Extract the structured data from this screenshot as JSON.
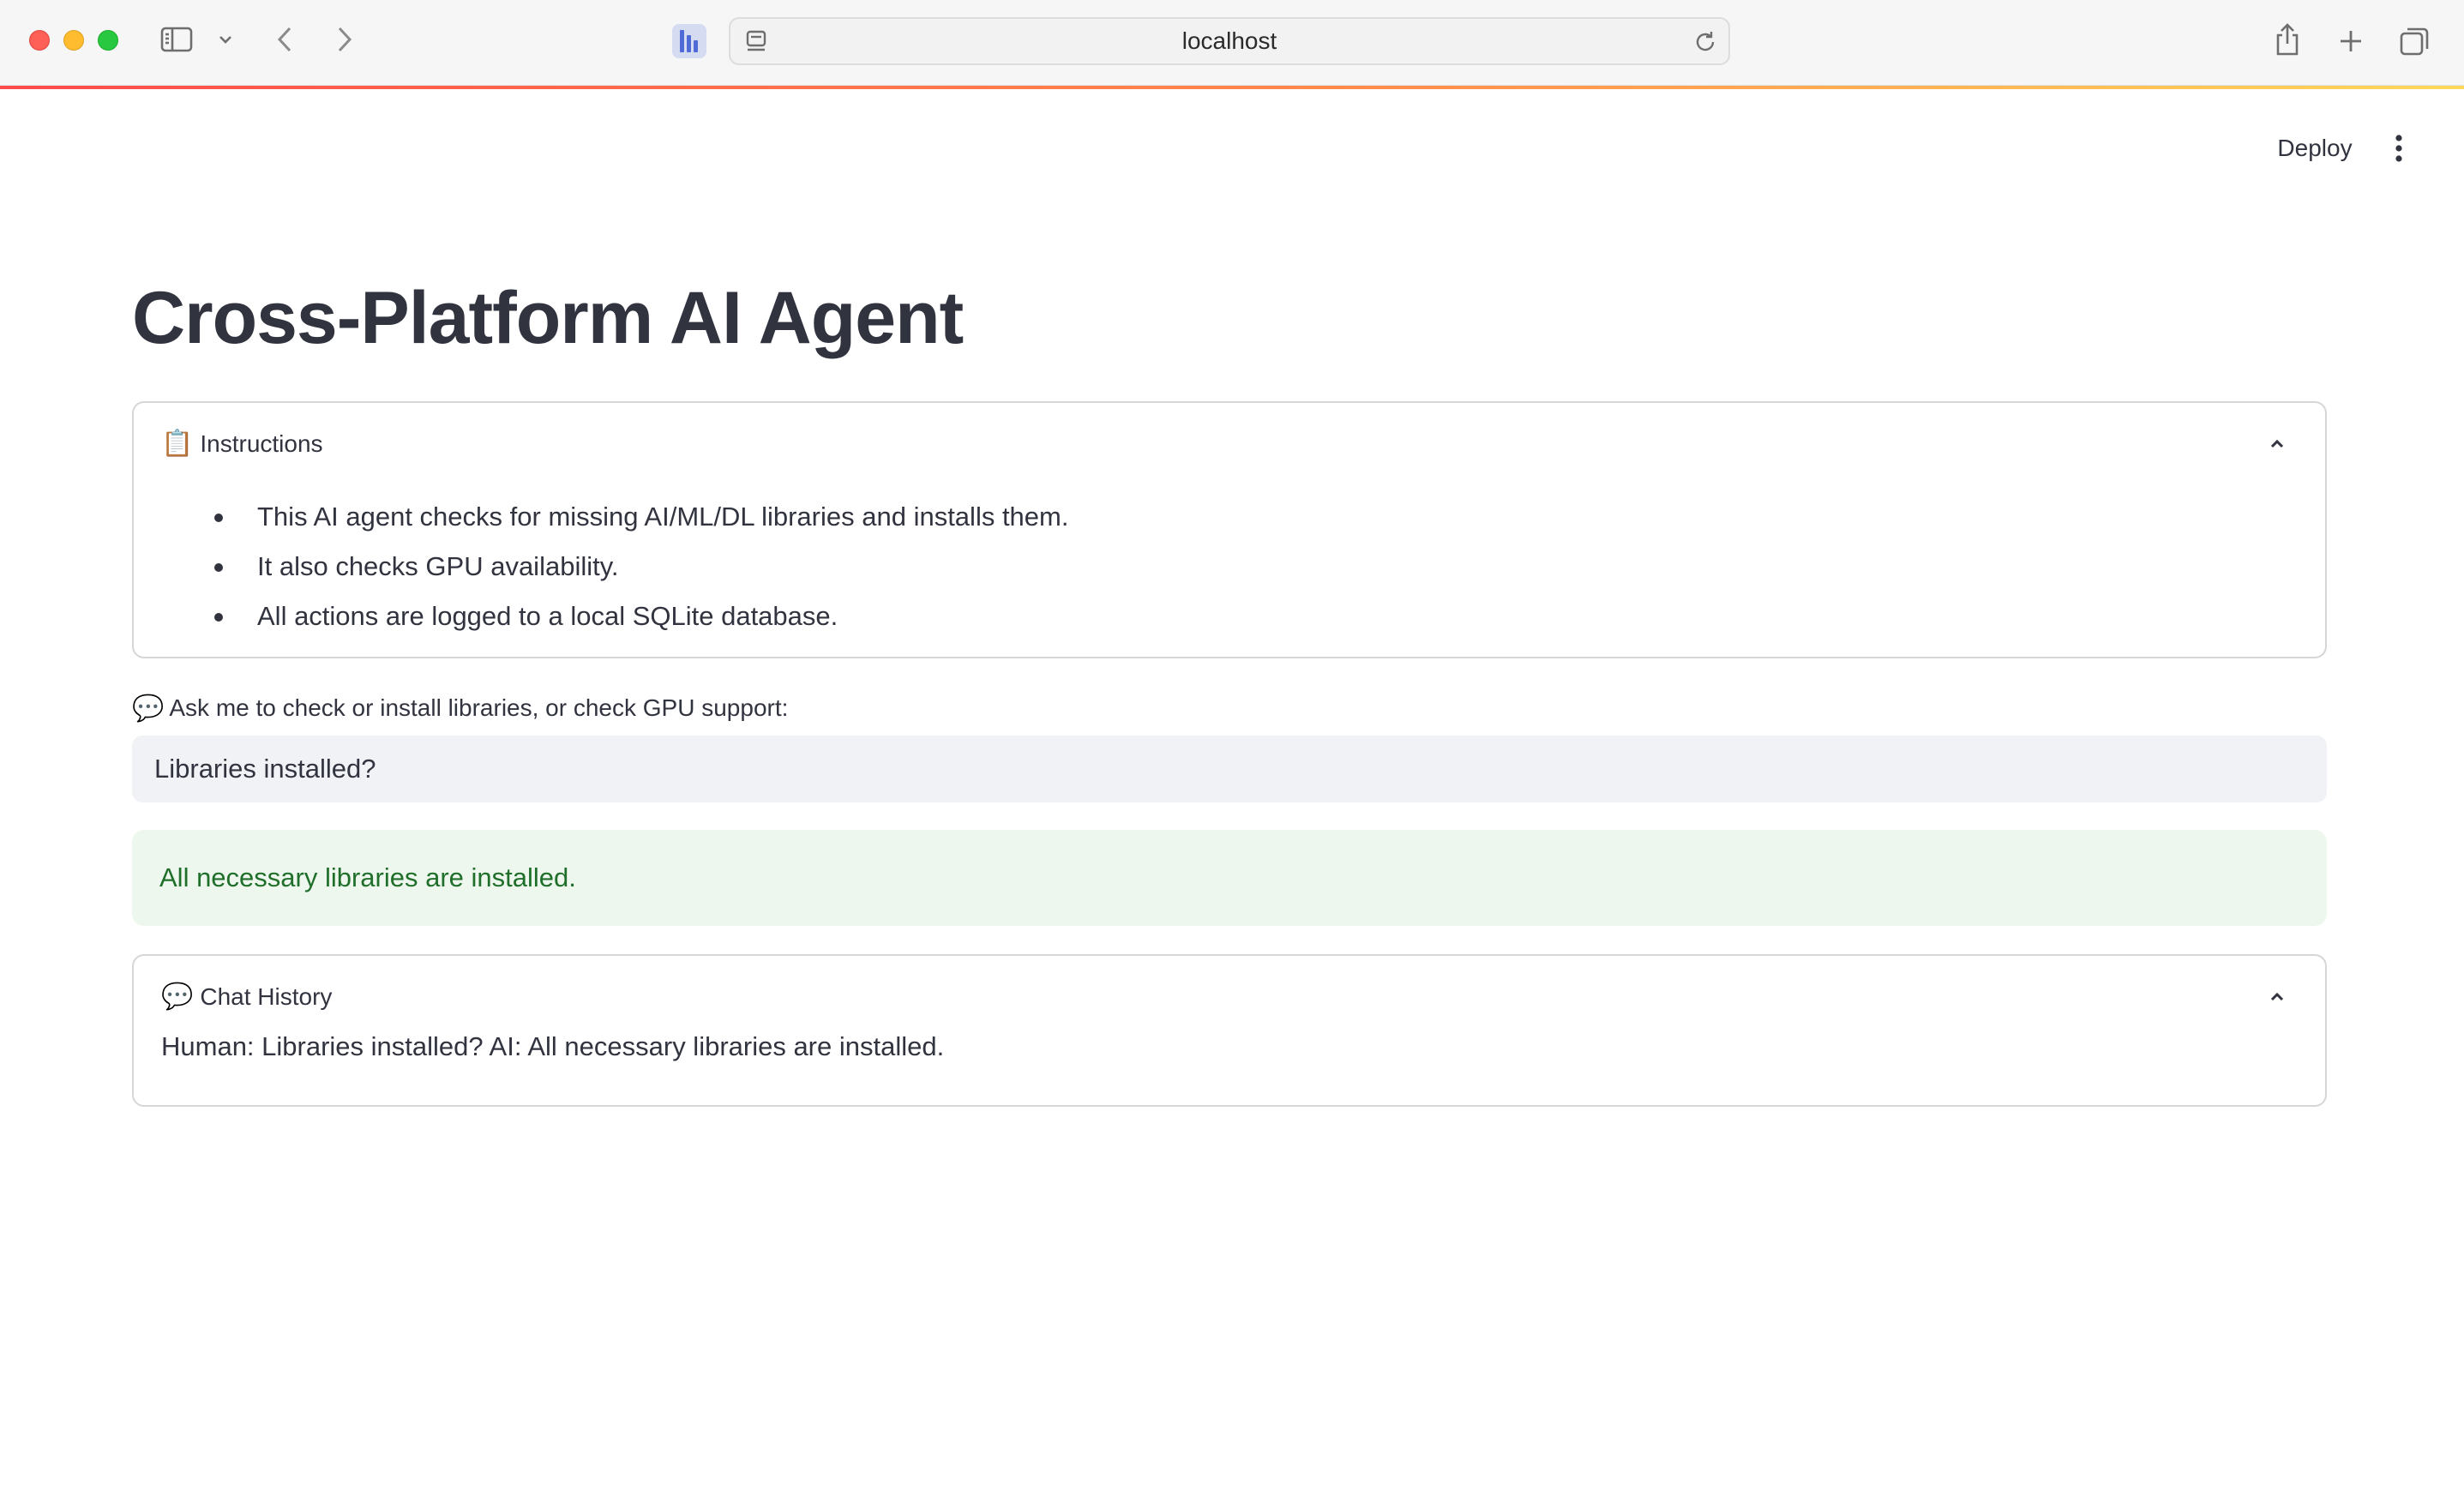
{
  "browser": {
    "url": "localhost",
    "accent_gradient": [
      "#ff4b4b",
      "#ff8a4b",
      "#fdd85a"
    ],
    "icons": [
      "sidebar-toggle-icon",
      "chevron-down-icon",
      "back-arrow-icon",
      "forward-arrow-icon",
      "extension-icon",
      "page-settings-icon",
      "reload-icon",
      "share-icon",
      "new-tab-icon",
      "tab-overview-icon"
    ]
  },
  "app_header": {
    "deploy_label": "Deploy",
    "menu_icon": "kebab-menu-icon"
  },
  "main": {
    "title": "Cross-Platform AI Agent",
    "instructions": {
      "emoji": "📋",
      "label": "Instructions",
      "items": [
        "This AI agent checks for missing AI/ML/DL libraries and installs them.",
        "It also checks GPU availability.",
        "All actions are logged to a local SQLite database."
      ]
    },
    "prompt": {
      "emoji": "💬",
      "label": "Ask me to check or install libraries, or check GPU support:",
      "value": "Libraries installed?"
    },
    "result": {
      "text": "All necessary libraries are installed.",
      "color": "#1f6f2b",
      "background": "#eef7ee"
    },
    "chat_history": {
      "emoji": "💬",
      "label": "Chat History",
      "text": "Human: Libraries installed? AI: All necessary libraries are installed."
    }
  }
}
